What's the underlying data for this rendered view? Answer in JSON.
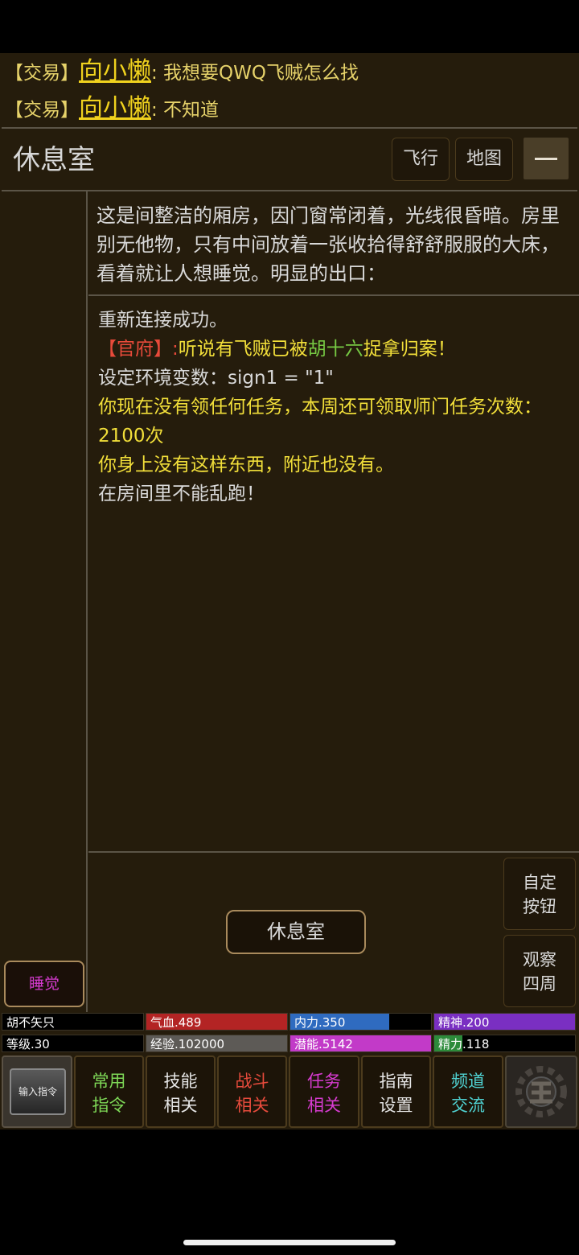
{
  "chat": [
    {
      "tag": "【交易】",
      "user": "向小懒",
      "message": ": 我想要QWQ飞贼怎么找"
    },
    {
      "tag": "【交易】",
      "user": "向小懒",
      "message": ": 不知道"
    }
  ],
  "header": {
    "room": "休息室",
    "fly": "飞行",
    "map": "地图"
  },
  "description": "这是间整洁的厢房，因门窗常闭着，光线很昏暗。房里别无他物，只有中间放着一张收拾得舒舒服服的大床，看着就让人想睡觉。明显的出口：",
  "log": {
    "line1": "重新连接成功。",
    "line2_tag": "【官府】:",
    "line2_a": "听说有飞贼已被",
    "line2_name": "胡十六",
    "line2_b": "捉拿归案！",
    "line3": "设定环境变数：sign1 = \"1\"",
    "line4": "你现在没有领任何任务，本周还可领取师门任务次数：2100次",
    "line5": "你身上没有这样东西，附近也没有。",
    "line6": "在房间里不能乱跑！"
  },
  "room_button": "休息室",
  "side": {
    "custom_1": "自定",
    "custom_2": "按钮",
    "look_1": "观察",
    "look_2": "四周"
  },
  "sleep_button": "睡觉",
  "stats": {
    "name": "胡不矢只",
    "hp": "气血.489",
    "neili": "内力.350",
    "jingshen": "精神.200",
    "level": "等级.30",
    "exp": "经验.102000",
    "potential": "潜能.5142",
    "jingli": "精力.118"
  },
  "stat_levels": {
    "hp": 1.0,
    "neili": 0.7,
    "jingshen": 1.0,
    "exp": 1.0,
    "potential": 1.0,
    "jingli": 0.2
  },
  "nav": {
    "input_cmd": "输入指令",
    "common_1": "常用",
    "common_2": "指令",
    "skill_1": "技能",
    "skill_2": "相关",
    "fight_1": "战斗",
    "fight_2": "相关",
    "task_1": "任务",
    "task_2": "相关",
    "guide_1": "指南",
    "guide_2": "设置",
    "channel_1": "频道",
    "channel_2": "交流"
  },
  "colors": {
    "hp": "#b32424",
    "neili": "#2f6bc0",
    "jingshen": "#7a2fc2",
    "exp": "#5d5a56",
    "potential": "#c23ac8",
    "jingli": "#2c8b3a"
  }
}
